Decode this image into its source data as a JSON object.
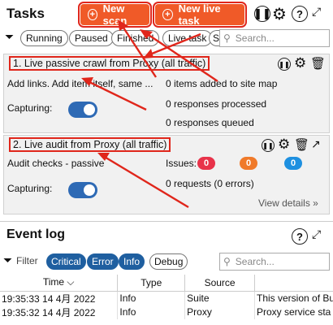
{
  "header": {
    "title": "Tasks",
    "new_scan_label": "New scan",
    "new_live_task_label": "New live task"
  },
  "filters": {
    "items": [
      "Running",
      "Paused",
      "Finished",
      "Live task",
      "S"
    ],
    "search_placeholder": "Search..."
  },
  "tasks": [
    {
      "title": "1. Live passive crawl from Proxy (all traffic)",
      "description": "Add links. Add item itself, same ...",
      "capturing_label": "Capturing:",
      "stats": [
        "0 items added to site map",
        "0 responses processed",
        "0 responses queued"
      ]
    },
    {
      "title": "2. Live audit from Proxy (all traffic)",
      "description": "Audit checks - passive",
      "capturing_label": "Capturing:",
      "issues_label": "Issues:",
      "issues": [
        {
          "count": "0",
          "color": "#e8334a"
        },
        {
          "count": "0",
          "color": "#f07a2a"
        },
        {
          "count": "0",
          "color": "#1e90e0"
        }
      ],
      "requests": "0 requests (0 errors)",
      "view_details": "View details »"
    }
  ],
  "splitter": "...",
  "event_log": {
    "title": "Event log",
    "filter_label": "Filter",
    "filters": [
      {
        "label": "Critical",
        "active": true
      },
      {
        "label": "Error",
        "active": true
      },
      {
        "label": "Info",
        "active": true
      },
      {
        "label": "Debug",
        "active": false
      }
    ],
    "search_placeholder": "Search...",
    "columns": [
      "Time ⌵",
      "Type",
      "Source",
      ""
    ],
    "rows": [
      {
        "time": "19:35:33 14 4月 2022",
        "type": "Info",
        "source": "Suite",
        "message": "This version of Bu"
      },
      {
        "time": "19:35:32 14 4月 2022",
        "type": "Info",
        "source": "Proxy",
        "message": "Proxy service sta"
      }
    ]
  }
}
